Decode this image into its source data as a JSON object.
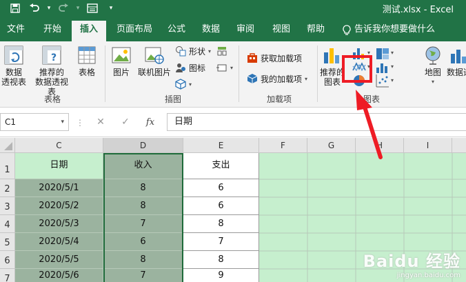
{
  "window": {
    "title": "测试.xlsx  -  Excel"
  },
  "quick_access": {
    "save": "save-icon",
    "undo": "undo-icon",
    "redo": "redo-icon",
    "form": "form-icon"
  },
  "tabs": [
    {
      "label": "文件",
      "active": false
    },
    {
      "label": "开始",
      "active": false
    },
    {
      "label": "插入",
      "active": true
    },
    {
      "label": "页面布局",
      "active": false
    },
    {
      "label": "公式",
      "active": false
    },
    {
      "label": "数据",
      "active": false
    },
    {
      "label": "审阅",
      "active": false
    },
    {
      "label": "视图",
      "active": false
    },
    {
      "label": "帮助",
      "active": false
    }
  ],
  "tell_me": "告诉我你想要做什么",
  "ribbon": {
    "tables": {
      "label": "表格",
      "pivot": "数据\n透视表",
      "recommended_pivot": "推荐的\n数据透视表",
      "table": "表格"
    },
    "illustrations": {
      "label": "插图",
      "pictures": "图片",
      "online_pictures": "联机图片",
      "shapes": "形状",
      "icons": "图标"
    },
    "addins": {
      "label": "加载项",
      "get_addins": "获取加载项",
      "my_addins": "我的加载项"
    },
    "charts": {
      "label": "图表",
      "recommended": "推荐的\n图表",
      "maps": "地图",
      "pivot_chart": "数据透"
    }
  },
  "formula_bar": {
    "name_box": "C1",
    "cancel": "✕",
    "enter": "✓",
    "fx": "fx",
    "value": "日期"
  },
  "sheet": {
    "columns": [
      "C",
      "D",
      "E",
      "F",
      "G",
      "H",
      "I"
    ],
    "rows": [
      "1",
      "2",
      "3",
      "4",
      "5",
      "6",
      "7"
    ],
    "header": [
      "日期",
      "收入",
      "支出"
    ],
    "data": [
      [
        "2020/5/1",
        "8",
        "6"
      ],
      [
        "2020/5/2",
        "8",
        "6"
      ],
      [
        "2020/5/3",
        "7",
        "8"
      ],
      [
        "2020/5/4",
        "6",
        "7"
      ],
      [
        "2020/5/5",
        "8",
        "8"
      ],
      [
        "2020/5/6",
        "7",
        "9"
      ]
    ]
  },
  "watermark": {
    "main": "Baidu 经验",
    "sub": "jingyan.baidu.com"
  },
  "colors": {
    "excel_green": "#217346",
    "highlight_red": "#ee1c25",
    "selection_tint": "#c6efce"
  }
}
